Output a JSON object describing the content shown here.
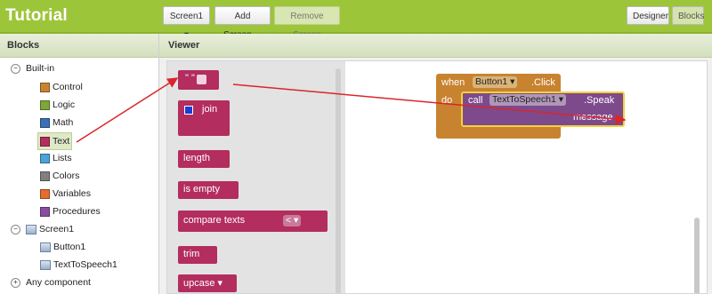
{
  "topbar": {
    "title": "Tutorial",
    "screen_dropdown": "Screen1 ▾",
    "add_screen": "Add Screen ...",
    "remove_screen": "Remove Screen",
    "designer": "Designer",
    "blocks": "Blocks"
  },
  "blocks_panel": {
    "header": "Blocks",
    "builtin": "Built-in",
    "items": [
      {
        "label": "Control",
        "color": "#c88330"
      },
      {
        "label": "Logic",
        "color": "#7ea63a"
      },
      {
        "label": "Math",
        "color": "#3b6fb6"
      },
      {
        "label": "Text",
        "color": "#b32d5e"
      },
      {
        "label": "Lists",
        "color": "#4aa3d9"
      },
      {
        "label": "Colors",
        "color": "#808080"
      },
      {
        "label": "Variables",
        "color": "#e46d2c"
      },
      {
        "label": "Procedures",
        "color": "#8a4ea0"
      }
    ],
    "screen": "Screen1",
    "components": [
      "Button1",
      "TextToSpeech1"
    ],
    "any_component": "Any component"
  },
  "viewer": {
    "header": "Viewer",
    "flyout": {
      "text_string": "\" \"",
      "join": "join",
      "length": "length",
      "is_empty": "is empty",
      "compare_texts": "compare texts",
      "compare_op": "< ▾",
      "trim": "trim",
      "upcase": "upcase ▾"
    },
    "event": {
      "when": "when",
      "component": "Button1 ▾",
      "event": ".Click",
      "do": "do",
      "call": "call",
      "call_component": "TextToSpeech1 ▾",
      "method": ".Speak",
      "param": "message"
    }
  }
}
